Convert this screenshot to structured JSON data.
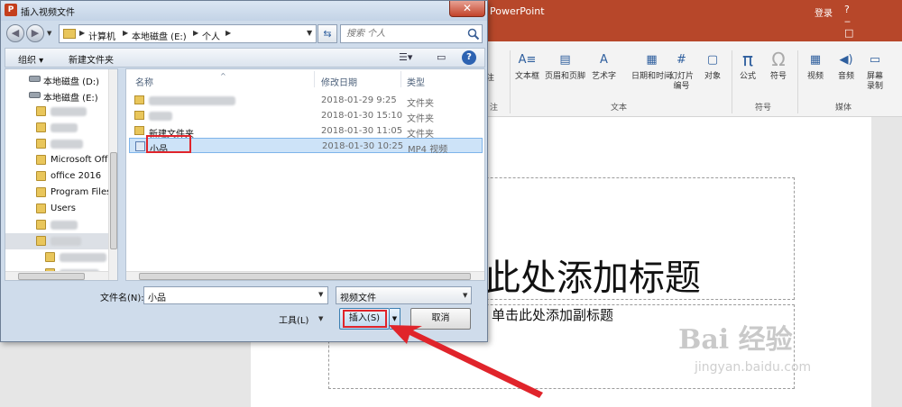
{
  "powerpoint": {
    "app_name": "PowerPoint",
    "login": "登录",
    "window_controls": "? ‒ □",
    "ribbon": {
      "buttons": [
        {
          "label": "文本框",
          "icon": "textbox-icon"
        },
        {
          "label": "页眉和页脚",
          "icon": "header-footer-icon"
        },
        {
          "label": "艺术字",
          "icon": "wordart-icon"
        },
        {
          "label": "日期和时间",
          "icon": "calendar-icon"
        },
        {
          "label": "幻灯片\n编号",
          "icon": "slide-number-icon"
        },
        {
          "label": "对象",
          "icon": "object-icon"
        },
        {
          "label": "公式",
          "icon": "pi-icon"
        },
        {
          "label": "符号",
          "icon": "omega-icon"
        },
        {
          "label": "视频",
          "icon": "film-icon"
        },
        {
          "label": "音频",
          "icon": "speaker-icon"
        },
        {
          "label": "屏幕\n录制",
          "icon": "screen-record-icon"
        }
      ],
      "partial_label": "注",
      "partial_label2": "注",
      "groups": [
        "文本",
        "符号",
        "媒体"
      ]
    },
    "slide": {
      "title": "此处添加标题",
      "subtitle": "单击此处添加副标题"
    },
    "watermark": {
      "text": "Bai 经验",
      "url": "jingyan.baidu.com"
    }
  },
  "dialog": {
    "title": "插入视频文件",
    "close_label": "✕",
    "address": {
      "crumbs": [
        "计算机",
        "本地磁盘 (E:)",
        "个人"
      ]
    },
    "search": {
      "placeholder": "搜索 个人"
    },
    "toolbar": {
      "organize": "组织 ▾",
      "new_folder": "新建文件夹"
    },
    "nav_tree": [
      {
        "label": "本地磁盘 (D:)",
        "kind": "drive"
      },
      {
        "label": "本地磁盘 (E:)",
        "kind": "drive"
      },
      {
        "label": "",
        "kind": "folder"
      },
      {
        "label": "",
        "kind": "folder"
      },
      {
        "label": "",
        "kind": "folder"
      },
      {
        "label": "Microsoft Off",
        "kind": "folder"
      },
      {
        "label": "office 2016",
        "kind": "folder"
      },
      {
        "label": "Program Files",
        "kind": "folder"
      },
      {
        "label": "Users",
        "kind": "folder"
      },
      {
        "label": "",
        "kind": "folder"
      },
      {
        "label": "",
        "kind": "folder"
      },
      {
        "label": "s",
        "kind": "folder"
      },
      {
        "label": "",
        "kind": "folder"
      }
    ],
    "columns": {
      "name": "名称",
      "modified": "修改日期",
      "type": "类型"
    },
    "files": [
      {
        "name": "",
        "modified": "2018-01-29 9:25",
        "type": "文件夹",
        "kind": "folder"
      },
      {
        "name": "",
        "modified": "2018-01-30 15:10",
        "type": "文件夹",
        "kind": "folder"
      },
      {
        "name": "新建文件夹",
        "modified": "2018-01-30 11:05",
        "type": "文件夹",
        "kind": "folder"
      },
      {
        "name": "小品",
        "modified": "2018-01-30 10:25",
        "type": "MP4 视频",
        "kind": "video"
      }
    ],
    "filename_label": "文件名(N):",
    "filename_value": "小品",
    "file_type_filter": "视频文件",
    "tools_label": "工具(L)",
    "insert_label": "插入(S)",
    "cancel_label": "取消"
  },
  "colors": {
    "ppt_accent": "#b7472a",
    "highlight_red": "#e0242b",
    "selection_blue": "#cde3f8"
  }
}
